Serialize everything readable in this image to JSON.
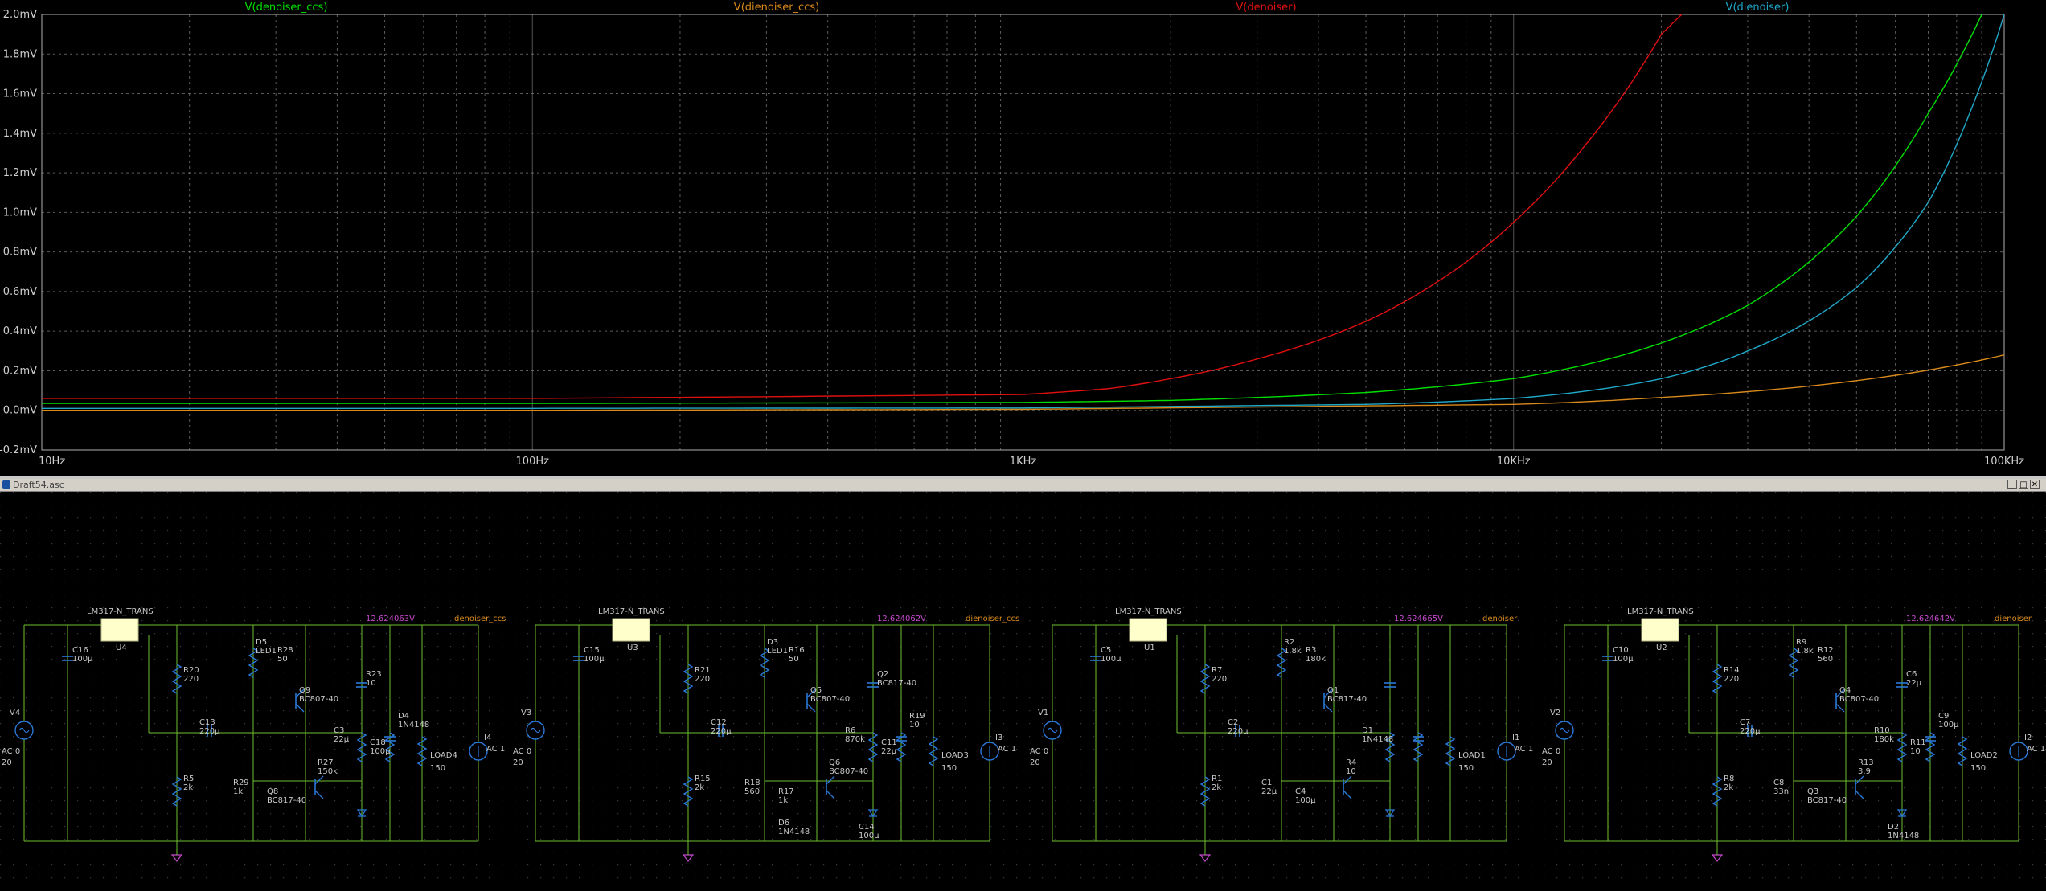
{
  "chart_data": {
    "type": "line",
    "xscale": "log",
    "xlim": [
      10,
      100000
    ],
    "ylim": [
      -0.2,
      2.0
    ],
    "x_ticks": [
      "10Hz",
      "100Hz",
      "1KHz",
      "10KHz",
      "100KHz"
    ],
    "y_ticks": [
      "2.0mV",
      "1.8mV",
      "1.6mV",
      "1.4mV",
      "1.2mV",
      "1.0mV",
      "0.8mV",
      "0.6mV",
      "0.4mV",
      "0.2mV",
      "0.0mV",
      "-0.2mV"
    ],
    "y_tick_values": [
      2.0,
      1.8,
      1.6,
      1.4,
      1.2,
      1.0,
      0.8,
      0.6,
      0.4,
      0.2,
      0.0,
      -0.2
    ],
    "grid": true,
    "series": [
      {
        "name": "V(denoiser_ccs)",
        "color": "#00e000",
        "x": [
          10,
          100,
          1000,
          2000,
          5000,
          10000,
          20000,
          30000,
          50000,
          70000,
          90000
        ],
        "y": [
          0.035,
          0.035,
          0.04,
          0.05,
          0.09,
          0.16,
          0.34,
          0.53,
          0.98,
          1.5,
          2.0
        ]
      },
      {
        "name": "V(dienoiser_ccs)",
        "color": "#d98a1c",
        "x": [
          10,
          100,
          1000,
          10000,
          20000,
          50000,
          100000
        ],
        "y": [
          0.0,
          0.0,
          0.005,
          0.03,
          0.065,
          0.15,
          0.28
        ]
      },
      {
        "name": "V(denoiser)",
        "color": "#e01010",
        "x": [
          10,
          100,
          1000,
          1500,
          2000,
          3000,
          5000,
          7000,
          10000,
          14000,
          17000,
          20000,
          22000
        ],
        "y": [
          0.06,
          0.06,
          0.08,
          0.11,
          0.16,
          0.26,
          0.45,
          0.65,
          0.95,
          1.34,
          1.62,
          1.9,
          2.0
        ]
      },
      {
        "name": "V(dienoiser)",
        "color": "#20a8c8",
        "x": [
          10,
          100,
          1000,
          5000,
          10000,
          20000,
          30000,
          50000,
          70000,
          85000,
          100000
        ],
        "y": [
          0.01,
          0.01,
          0.012,
          0.03,
          0.06,
          0.16,
          0.3,
          0.62,
          1.05,
          1.5,
          2.0
        ]
      }
    ]
  },
  "window": {
    "title": "Draft54.asc",
    "minimize": "_",
    "maximize": "□",
    "close": "✕"
  },
  "schematic": {
    "blocks": [
      {
        "reg_label": "LM317-N_TRANS",
        "reg_ref": "U4",
        "net_voltage": "12.624063V",
        "net_name": "denoiser_ccs",
        "src_ref": "V4",
        "src_val1": "AC 0",
        "src_val2": "20",
        "load_ref": "LOAD4",
        "load_val": "150",
        "isrc_ref": "I4",
        "isrc_val": "AC 1",
        "parts": [
          [
            "C16",
            "100µ"
          ],
          [
            "R20",
            "220"
          ],
          [
            "R5",
            "2k"
          ],
          [
            "C13",
            "220µ"
          ],
          [
            "D5",
            "LED1"
          ],
          [
            "R28",
            "50"
          ],
          [
            "Q9",
            "BC807-40"
          ],
          [
            "R29",
            "1k"
          ],
          [
            "R27",
            "150k"
          ],
          [
            "Q8",
            "BC817-40"
          ],
          [
            "C3",
            "22µ"
          ],
          [
            "R23",
            "10"
          ],
          [
            "C18",
            "100µ"
          ],
          [
            "D4",
            "1N4148"
          ]
        ]
      },
      {
        "reg_label": "LM317-N_TRANS",
        "reg_ref": "U3",
        "net_voltage": "12.624062V",
        "net_name": "dienoiser_ccs",
        "src_ref": "V3",
        "src_val1": "AC 0",
        "src_val2": "20",
        "load_ref": "LOAD3",
        "load_val": "150",
        "isrc_ref": "I3",
        "isrc_val": "AC 1",
        "parts": [
          [
            "C15",
            "100µ"
          ],
          [
            "R21",
            "220"
          ],
          [
            "R15",
            "2k"
          ],
          [
            "C12",
            "220µ"
          ],
          [
            "D3",
            "LED1"
          ],
          [
            "R16",
            "50"
          ],
          [
            "Q5",
            "BC807-40"
          ],
          [
            "R18",
            "560"
          ],
          [
            "Q6",
            "BC807-40"
          ],
          [
            "R17",
            "1k"
          ],
          [
            "R6",
            "870k"
          ],
          [
            "Q2",
            "BC817-40"
          ],
          [
            "C11",
            "22µ"
          ],
          [
            "R19",
            "10"
          ],
          [
            "C14",
            "100µ"
          ],
          [
            "D6",
            "1N4148"
          ]
        ]
      },
      {
        "reg_label": "LM317-N_TRANS",
        "reg_ref": "U1",
        "net_voltage": "12.624665V",
        "net_name": "denoiser",
        "src_ref": "V1",
        "src_val1": "AC 0",
        "src_val2": "20",
        "load_ref": "LOAD1",
        "load_val": "150",
        "isrc_ref": "I1",
        "isrc_val": "AC 1",
        "parts": [
          [
            "C5",
            "100µ"
          ],
          [
            "R7",
            "220"
          ],
          [
            "R1",
            "2k"
          ],
          [
            "C2",
            "220µ"
          ],
          [
            "R2",
            "1.8k"
          ],
          [
            "R3",
            "180k"
          ],
          [
            "Q1",
            "BC817-40"
          ],
          [
            "C1",
            "22µ"
          ],
          [
            "R4",
            "10"
          ],
          [
            "C4",
            "100µ"
          ],
          [
            "D1",
            "1N4148"
          ]
        ]
      },
      {
        "reg_label": "LM317-N_TRANS",
        "reg_ref": "U2",
        "net_voltage": "12.624642V",
        "net_name": "dienoiser",
        "src_ref": "V2",
        "src_val1": "AC 0",
        "src_val2": "20",
        "load_ref": "LOAD2",
        "load_val": "150",
        "isrc_ref": "I2",
        "isrc_val": "AC 1",
        "parts": [
          [
            "C10",
            "100µ"
          ],
          [
            "R14",
            "220"
          ],
          [
            "R8",
            "2k"
          ],
          [
            "C7",
            "220µ"
          ],
          [
            "R9",
            "1.8k"
          ],
          [
            "R12",
            "560"
          ],
          [
            "Q4",
            "BC807-40"
          ],
          [
            "C8",
            "33n"
          ],
          [
            "R13",
            "3.9"
          ],
          [
            "Q3",
            "BC817-40"
          ],
          [
            "R10",
            "180k"
          ],
          [
            "C6",
            "22µ"
          ],
          [
            "R11",
            "10"
          ],
          [
            "C9",
            "100µ"
          ],
          [
            "D2",
            "1N4148"
          ]
        ]
      }
    ]
  }
}
